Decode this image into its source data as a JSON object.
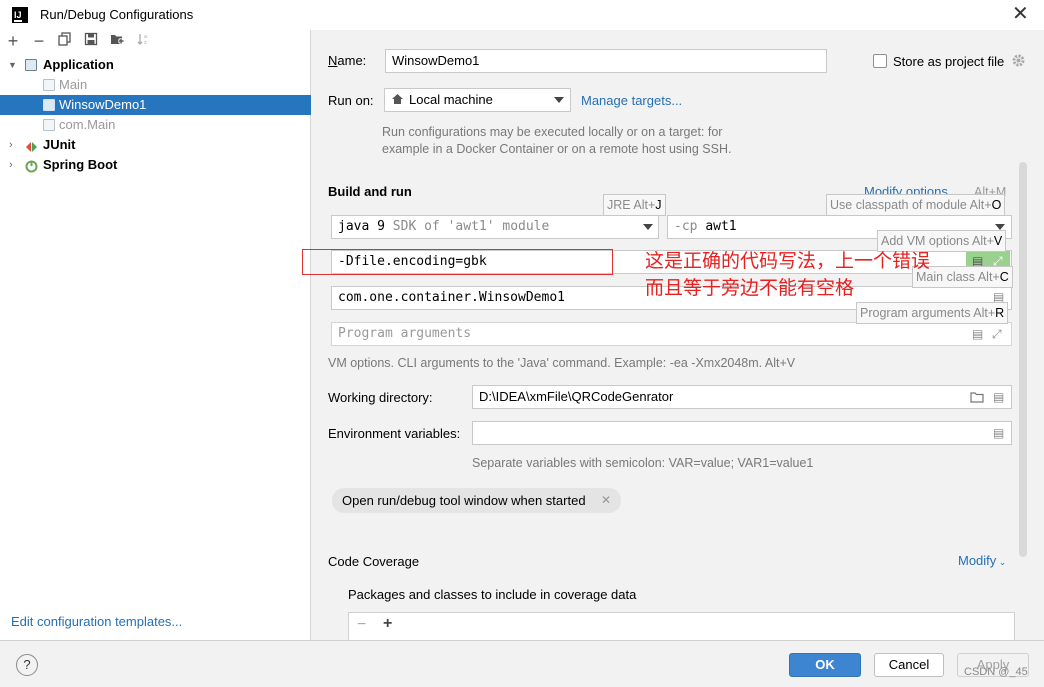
{
  "window": {
    "title": "Run/Debug Configurations",
    "app_icon_text": "IJ",
    "close_glyph": "✕"
  },
  "toolbar": {
    "icons": [
      "add-icon",
      "remove-icon",
      "copy-icon",
      "save-icon",
      "new-folder-icon",
      "sort-icon"
    ]
  },
  "tree": {
    "groups": [
      {
        "label": "Application",
        "expanded": true,
        "children": [
          "Main",
          "WinsowDemo1",
          "com.Main"
        ],
        "selected_child": "WinsowDemo1"
      },
      {
        "label": "JUnit",
        "expanded": false
      },
      {
        "label": "Spring Boot",
        "expanded": false
      }
    ]
  },
  "left_footer": {
    "edit_templates": "Edit configuration templates..."
  },
  "form": {
    "name_label": "Name:",
    "name_value": "WinsowDemo1",
    "store_label": "Store as project file",
    "store_checked": false,
    "run_on_label": "Run on:",
    "run_on_value": "Local machine",
    "manage_targets": "Manage targets...",
    "run_on_hint_1": "Run configurations may be executed locally or on a target: for",
    "run_on_hint_2": "example in a Docker Container or on a remote host using SSH.",
    "build_and_run": "Build and run",
    "modify_options": "Modify options",
    "modify_shortcut": "Alt+M",
    "jre_java": "java",
    "jre_version": "9",
    "jre_detail": "SDK of 'awt1' module",
    "cp_prefix": "-cp",
    "cp_value": "awt1",
    "vm_options_value": "-Dfile.encoding=gbk",
    "main_class_value": "com.one.container.WinsowDemo1",
    "program_args_placeholder": "Program arguments",
    "vm_hint": "VM options. CLI arguments to the 'Java' command. Example: -ea -Xmx2048m. Alt+V",
    "working_dir_label": "Working directory:",
    "working_dir_value": "D:\\IDEA\\xmFile\\QRCodeGenrator",
    "env_vars_label": "Environment variables:",
    "env_vars_value": "",
    "env_hint": "Separate variables with semicolon: VAR=value; VAR1=value1",
    "chip_label": "Open run/debug tool window when started",
    "code_coverage": "Code Coverage",
    "modify": "Modify",
    "coverage_packages": "Packages and classes to include in coverage data"
  },
  "tooltips": {
    "jre_text": "JRE Alt+",
    "jre_key": "J",
    "classpath_text": "Use classpath of module Alt+",
    "classpath_key": "O",
    "vm_text": "Add VM options Alt+",
    "vm_key": "V",
    "main_text": "Main class Alt+",
    "main_key": "C",
    "prog_text": "Program arguments Alt+",
    "prog_key": "R"
  },
  "annotation": {
    "line1": "这是正确的代码写法，上一个错误",
    "line2": "而且等于旁边不能有空格",
    "color": "#e82020"
  },
  "buttons": {
    "help": "?",
    "ok": "OK",
    "cancel": "Cancel",
    "apply": "Apply"
  },
  "watermark": "CSDN @_45",
  "colors": {
    "selection": "#2675bf",
    "link": "#2470b3",
    "ok_button": "#3d85d1"
  }
}
